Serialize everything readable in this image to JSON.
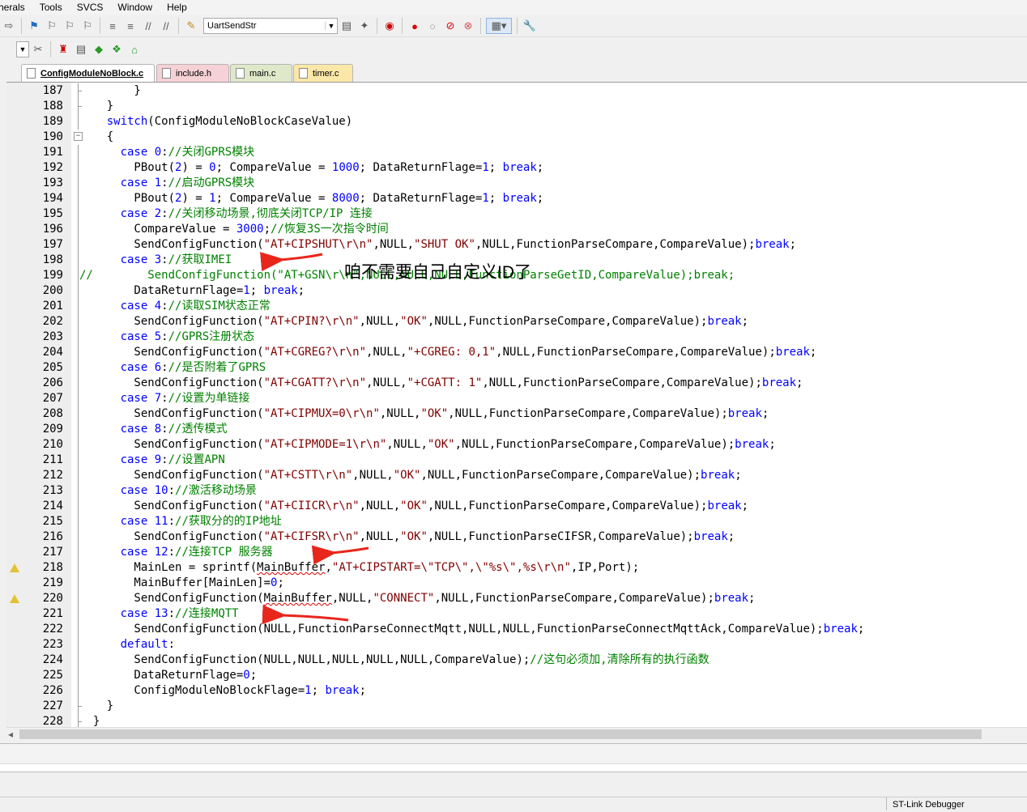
{
  "menu": [
    "herals",
    "Tools",
    "SVCS",
    "Window",
    "Help"
  ],
  "toolbar": {
    "target_combo": "UartSendStr"
  },
  "tabs": [
    {
      "label": "ConfigModuleNoBlock.c",
      "color": "#ffffff",
      "active": true
    },
    {
      "label": "include.h",
      "color": "#f6d1d6",
      "active": false
    },
    {
      "label": "main.c",
      "color": "#dfe8c8",
      "active": false
    },
    {
      "label": "timer.c",
      "color": "#fbe8a8",
      "active": false
    }
  ],
  "annotation": "咱不需要自己自定义ID了",
  "status": {
    "debugger": "ST-Link Debugger"
  },
  "warning_lines": [
    218,
    220
  ],
  "lines": [
    {
      "n": "187",
      "t": [
        [
          "p",
          "        }"
        ]
      ]
    },
    {
      "n": "188",
      "t": [
        [
          "p",
          "    }"
        ]
      ]
    },
    {
      "n": "189",
      "t": [
        [
          "p",
          "    "
        ],
        [
          "k",
          "switch"
        ],
        [
          "p",
          "(ConfigModuleNoBlockCaseValue)"
        ]
      ]
    },
    {
      "n": "190",
      "t": [
        [
          "p",
          "    {"
        ]
      ]
    },
    {
      "n": "191",
      "t": [
        [
          "p",
          "      "
        ],
        [
          "k",
          "case"
        ],
        [
          "p",
          " "
        ],
        [
          "n",
          "0"
        ],
        [
          "p",
          ":"
        ],
        [
          "c",
          "//关闭GPRS模块"
        ]
      ]
    },
    {
      "n": "192",
      "t": [
        [
          "p",
          "        PBout("
        ],
        [
          "n",
          "2"
        ],
        [
          "p",
          ") = "
        ],
        [
          "n",
          "0"
        ],
        [
          "p",
          "; CompareValue = "
        ],
        [
          "n",
          "1000"
        ],
        [
          "p",
          "; DataReturnFlage="
        ],
        [
          "n",
          "1"
        ],
        [
          "p",
          "; "
        ],
        [
          "k",
          "break"
        ],
        [
          "p",
          ";"
        ]
      ]
    },
    {
      "n": "193",
      "t": [
        [
          "p",
          "      "
        ],
        [
          "k",
          "case"
        ],
        [
          "p",
          " "
        ],
        [
          "n",
          "1"
        ],
        [
          "p",
          ":"
        ],
        [
          "c",
          "//启动GPRS模块"
        ]
      ]
    },
    {
      "n": "194",
      "t": [
        [
          "p",
          "        PBout("
        ],
        [
          "n",
          "2"
        ],
        [
          "p",
          ") = "
        ],
        [
          "n",
          "1"
        ],
        [
          "p",
          "; CompareValue = "
        ],
        [
          "n",
          "8000"
        ],
        [
          "p",
          "; DataReturnFlage="
        ],
        [
          "n",
          "1"
        ],
        [
          "p",
          "; "
        ],
        [
          "k",
          "break"
        ],
        [
          "p",
          ";"
        ]
      ]
    },
    {
      "n": "195",
      "t": [
        [
          "p",
          "      "
        ],
        [
          "k",
          "case"
        ],
        [
          "p",
          " "
        ],
        [
          "n",
          "2"
        ],
        [
          "p",
          ":"
        ],
        [
          "c",
          "//关闭移动场景,彻底关闭TCP/IP 连接"
        ]
      ]
    },
    {
      "n": "196",
      "t": [
        [
          "p",
          "        CompareValue = "
        ],
        [
          "n",
          "3000"
        ],
        [
          "p",
          ";"
        ],
        [
          "c",
          "//恢复3S一次指令时间"
        ]
      ]
    },
    {
      "n": "197",
      "t": [
        [
          "p",
          "        SendConfigFunction("
        ],
        [
          "s",
          "\"AT+CIPSHUT\\r\\n\""
        ],
        [
          "p",
          ",NULL,"
        ],
        [
          "s",
          "\"SHUT OK\""
        ],
        [
          "p",
          ",NULL,FunctionParseCompare,CompareValue);"
        ],
        [
          "k",
          "break"
        ],
        [
          "p",
          ";"
        ]
      ]
    },
    {
      "n": "198",
      "t": [
        [
          "p",
          "      "
        ],
        [
          "k",
          "case"
        ],
        [
          "p",
          " "
        ],
        [
          "n",
          "3"
        ],
        [
          "p",
          ":"
        ],
        [
          "c",
          "//获取IMEI"
        ]
      ]
    },
    {
      "n": "199",
      "t": [
        [
          "c",
          "//        SendConfigFunction(\"AT+GSN\\r\\n\",NULL,NULL,NULL,FunctionParseGetID,CompareValue);break;"
        ]
      ]
    },
    {
      "n": "200",
      "t": [
        [
          "p",
          "        DataReturnFlage="
        ],
        [
          "n",
          "1"
        ],
        [
          "p",
          "; "
        ],
        [
          "k",
          "break"
        ],
        [
          "p",
          ";"
        ]
      ]
    },
    {
      "n": "201",
      "t": [
        [
          "p",
          "      "
        ],
        [
          "k",
          "case"
        ],
        [
          "p",
          " "
        ],
        [
          "n",
          "4"
        ],
        [
          "p",
          ":"
        ],
        [
          "c",
          "//读取SIM状态正常"
        ]
      ]
    },
    {
      "n": "202",
      "t": [
        [
          "p",
          "        SendConfigFunction("
        ],
        [
          "s",
          "\"AT+CPIN?\\r\\n\""
        ],
        [
          "p",
          ",NULL,"
        ],
        [
          "s",
          "\"OK\""
        ],
        [
          "p",
          ",NULL,FunctionParseCompare,CompareValue);"
        ],
        [
          "k",
          "break"
        ],
        [
          "p",
          ";"
        ]
      ]
    },
    {
      "n": "203",
      "t": [
        [
          "p",
          "      "
        ],
        [
          "k",
          "case"
        ],
        [
          "p",
          " "
        ],
        [
          "n",
          "5"
        ],
        [
          "p",
          ":"
        ],
        [
          "c",
          "//GPRS注册状态"
        ]
      ]
    },
    {
      "n": "204",
      "t": [
        [
          "p",
          "        SendConfigFunction("
        ],
        [
          "s",
          "\"AT+CGREG?\\r\\n\""
        ],
        [
          "p",
          ",NULL,"
        ],
        [
          "s",
          "\"+CGREG: 0,1\""
        ],
        [
          "p",
          ",NULL,FunctionParseCompare,CompareValue);"
        ],
        [
          "k",
          "break"
        ],
        [
          "p",
          ";"
        ]
      ]
    },
    {
      "n": "205",
      "t": [
        [
          "p",
          "      "
        ],
        [
          "k",
          "case"
        ],
        [
          "p",
          " "
        ],
        [
          "n",
          "6"
        ],
        [
          "p",
          ":"
        ],
        [
          "c",
          "//是否附着了GPRS"
        ]
      ]
    },
    {
      "n": "206",
      "t": [
        [
          "p",
          "        SendConfigFunction("
        ],
        [
          "s",
          "\"AT+CGATT?\\r\\n\""
        ],
        [
          "p",
          ",NULL,"
        ],
        [
          "s",
          "\"+CGATT: 1\""
        ],
        [
          "p",
          ",NULL,FunctionParseCompare,CompareValue);"
        ],
        [
          "k",
          "break"
        ],
        [
          "p",
          ";"
        ]
      ]
    },
    {
      "n": "207",
      "t": [
        [
          "p",
          "      "
        ],
        [
          "k",
          "case"
        ],
        [
          "p",
          " "
        ],
        [
          "n",
          "7"
        ],
        [
          "p",
          ":"
        ],
        [
          "c",
          "//设置为单链接"
        ]
      ]
    },
    {
      "n": "208",
      "t": [
        [
          "p",
          "        SendConfigFunction("
        ],
        [
          "s",
          "\"AT+CIPMUX=0\\r\\n\""
        ],
        [
          "p",
          ",NULL,"
        ],
        [
          "s",
          "\"OK\""
        ],
        [
          "p",
          ",NULL,FunctionParseCompare,CompareValue);"
        ],
        [
          "k",
          "break"
        ],
        [
          "p",
          ";"
        ]
      ]
    },
    {
      "n": "209",
      "t": [
        [
          "p",
          "      "
        ],
        [
          "k",
          "case"
        ],
        [
          "p",
          " "
        ],
        [
          "n",
          "8"
        ],
        [
          "p",
          ":"
        ],
        [
          "c",
          "//透传模式"
        ]
      ]
    },
    {
      "n": "210",
      "t": [
        [
          "p",
          "        SendConfigFunction("
        ],
        [
          "s",
          "\"AT+CIPMODE=1\\r\\n\""
        ],
        [
          "p",
          ",NULL,"
        ],
        [
          "s",
          "\"OK\""
        ],
        [
          "p",
          ",NULL,FunctionParseCompare,CompareValue);"
        ],
        [
          "k",
          "break"
        ],
        [
          "p",
          ";"
        ]
      ]
    },
    {
      "n": "211",
      "t": [
        [
          "p",
          "      "
        ],
        [
          "k",
          "case"
        ],
        [
          "p",
          " "
        ],
        [
          "n",
          "9"
        ],
        [
          "p",
          ":"
        ],
        [
          "c",
          "//设置APN"
        ]
      ]
    },
    {
      "n": "212",
      "t": [
        [
          "p",
          "        SendConfigFunction("
        ],
        [
          "s",
          "\"AT+CSTT\\r\\n\""
        ],
        [
          "p",
          ",NULL,"
        ],
        [
          "s",
          "\"OK\""
        ],
        [
          "p",
          ",NULL,FunctionParseCompare,CompareValue);"
        ],
        [
          "k",
          "break"
        ],
        [
          "p",
          ";"
        ]
      ]
    },
    {
      "n": "213",
      "t": [
        [
          "p",
          "      "
        ],
        [
          "k",
          "case"
        ],
        [
          "p",
          " "
        ],
        [
          "n",
          "10"
        ],
        [
          "p",
          ":"
        ],
        [
          "c",
          "//激活移动场景"
        ]
      ]
    },
    {
      "n": "214",
      "t": [
        [
          "p",
          "        SendConfigFunction("
        ],
        [
          "s",
          "\"AT+CIICR\\r\\n\""
        ],
        [
          "p",
          ",NULL,"
        ],
        [
          "s",
          "\"OK\""
        ],
        [
          "p",
          ",NULL,FunctionParseCompare,CompareValue);"
        ],
        [
          "k",
          "break"
        ],
        [
          "p",
          ";"
        ]
      ]
    },
    {
      "n": "215",
      "t": [
        [
          "p",
          "      "
        ],
        [
          "k",
          "case"
        ],
        [
          "p",
          " "
        ],
        [
          "n",
          "11"
        ],
        [
          "p",
          ":"
        ],
        [
          "c",
          "//获取分的的IP地址"
        ]
      ]
    },
    {
      "n": "216",
      "t": [
        [
          "p",
          "        SendConfigFunction("
        ],
        [
          "s",
          "\"AT+CIFSR\\r\\n\""
        ],
        [
          "p",
          ",NULL,"
        ],
        [
          "s",
          "\"OK\""
        ],
        [
          "p",
          ",NULL,FunctionParseCIFSR,CompareValue);"
        ],
        [
          "k",
          "break"
        ],
        [
          "p",
          ";"
        ]
      ]
    },
    {
      "n": "217",
      "t": [
        [
          "p",
          "      "
        ],
        [
          "k",
          "case"
        ],
        [
          "p",
          " "
        ],
        [
          "n",
          "12"
        ],
        [
          "p",
          ":"
        ],
        [
          "c",
          "//连接TCP 服务器"
        ]
      ]
    },
    {
      "n": "218",
      "t": [
        [
          "p",
          "        MainLen = sprintf("
        ],
        [
          "w",
          "MainBuffer"
        ],
        [
          "p",
          ","
        ],
        [
          "s",
          "\"AT+CIPSTART=\\\"TCP\\\",\\\"%s\\\",%s\\r\\n\""
        ],
        [
          "p",
          ",IP,Port);"
        ]
      ]
    },
    {
      "n": "219",
      "t": [
        [
          "p",
          "        MainBuffer[MainLen]="
        ],
        [
          "n",
          "0"
        ],
        [
          "p",
          ";"
        ]
      ]
    },
    {
      "n": "220",
      "t": [
        [
          "p",
          "        SendConfigFunction("
        ],
        [
          "w",
          "MainBuffer"
        ],
        [
          "p",
          ",NULL,"
        ],
        [
          "s",
          "\"CONNECT\""
        ],
        [
          "p",
          ",NULL,FunctionParseCompare,CompareValue);"
        ],
        [
          "k",
          "break"
        ],
        [
          "p",
          ";"
        ]
      ]
    },
    {
      "n": "221",
      "t": [
        [
          "p",
          "      "
        ],
        [
          "k",
          "case"
        ],
        [
          "p",
          " "
        ],
        [
          "n",
          "13"
        ],
        [
          "p",
          ":"
        ],
        [
          "c",
          "//连接MQTT"
        ]
      ]
    },
    {
      "n": "222",
      "t": [
        [
          "p",
          "        SendConfigFunction(NULL,FunctionParseConnectMqtt,NULL,NULL,FunctionParseConnectMqttAck,CompareValue);"
        ],
        [
          "k",
          "break"
        ],
        [
          "p",
          ";"
        ]
      ]
    },
    {
      "n": "223",
      "t": [
        [
          "p",
          "      "
        ],
        [
          "k",
          "default"
        ],
        [
          "p",
          ":"
        ]
      ]
    },
    {
      "n": "224",
      "t": [
        [
          "p",
          "        SendConfigFunction(NULL,NULL,NULL,NULL,NULL,CompareValue);"
        ],
        [
          "c",
          "//这句必须加,清除所有的执行函数"
        ]
      ]
    },
    {
      "n": "225",
      "t": [
        [
          "p",
          "        DataReturnFlage="
        ],
        [
          "n",
          "0"
        ],
        [
          "p",
          ";"
        ]
      ]
    },
    {
      "n": "226",
      "t": [
        [
          "p",
          "        ConfigModuleNoBlockFlage="
        ],
        [
          "n",
          "1"
        ],
        [
          "p",
          "; "
        ],
        [
          "k",
          "break"
        ],
        [
          "p",
          ";"
        ]
      ]
    },
    {
      "n": "227",
      "t": [
        [
          "p",
          "    }"
        ]
      ]
    },
    {
      "n": "228",
      "t": [
        [
          "p",
          "  }"
        ]
      ]
    }
  ]
}
